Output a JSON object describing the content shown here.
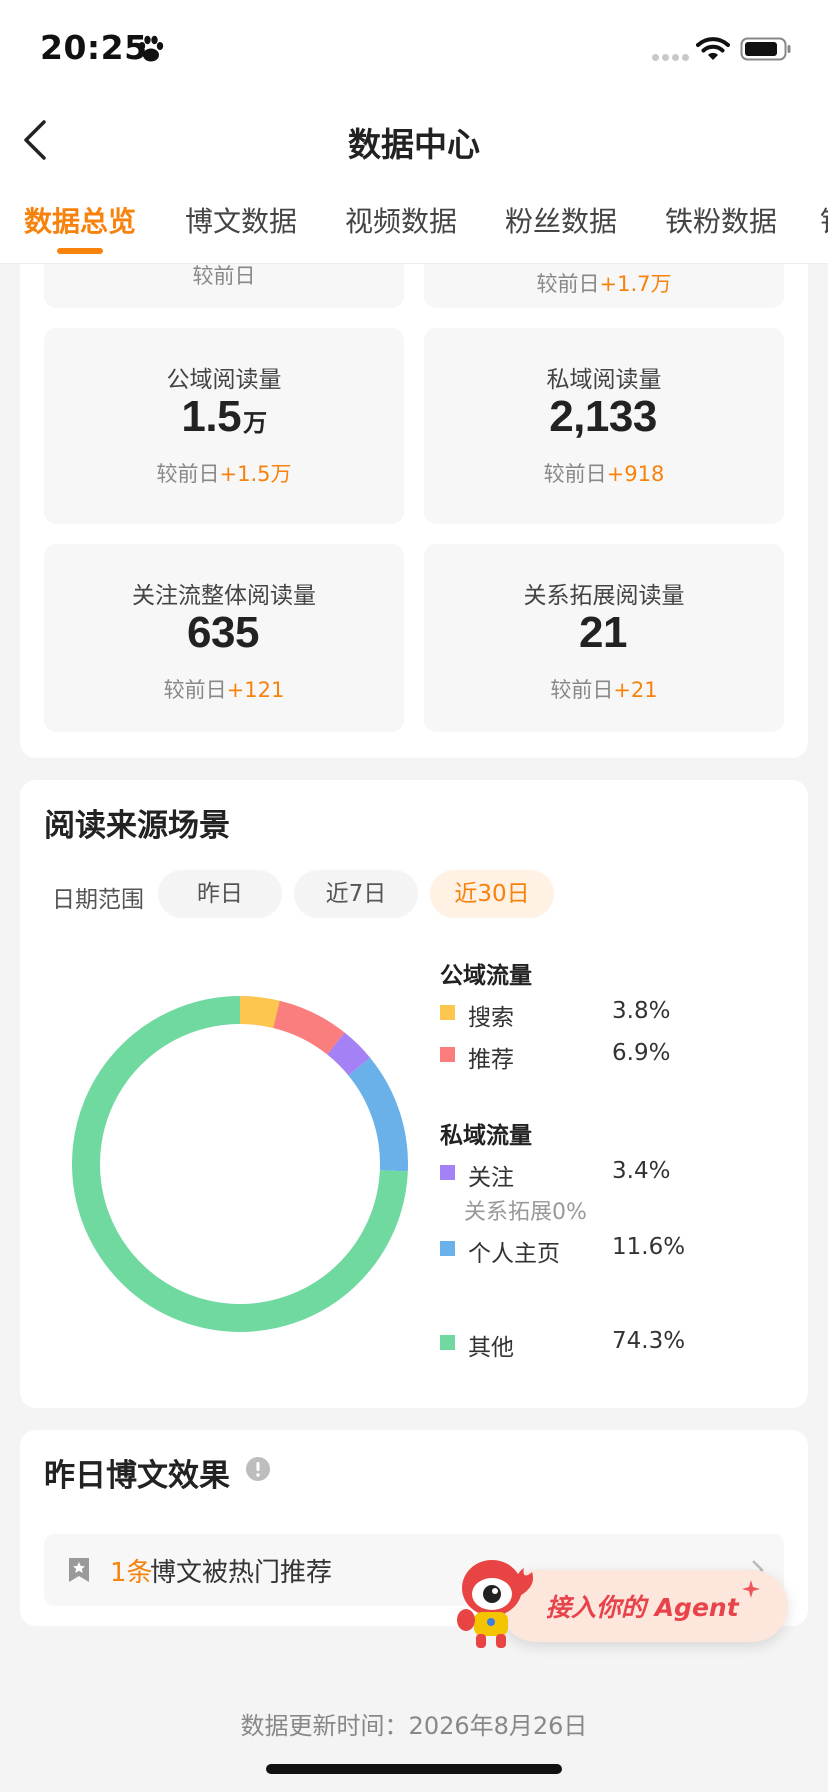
{
  "status_bar": {
    "time": "20:25"
  },
  "nav": {
    "title": "数据中心"
  },
  "tabs": [
    {
      "label": "数据总览",
      "active": true
    },
    {
      "label": "博文数据"
    },
    {
      "label": "视频数据"
    },
    {
      "label": "粉丝数据"
    },
    {
      "label": "铁粉数据"
    },
    {
      "label": "铁"
    }
  ],
  "top_partial": {
    "left_cmp": "较前日",
    "right_cmp_prefix": "较前日",
    "right_cmp_delta": "+1.7万"
  },
  "stats": [
    {
      "label": "公域阅读量",
      "value": "1.5",
      "unit": "万",
      "cmp_prefix": "较前日",
      "cmp_delta": "+1.5万"
    },
    {
      "label": "私域阅读量",
      "value": "2,133",
      "unit": "",
      "cmp_prefix": "较前日",
      "cmp_delta": "+918"
    },
    {
      "label": "关注流整体阅读量",
      "value": "635",
      "unit": "",
      "cmp_prefix": "较前日",
      "cmp_delta": "+121"
    },
    {
      "label": "关系拓展阅读量",
      "value": "21",
      "unit": "",
      "cmp_prefix": "较前日",
      "cmp_delta": "+21"
    }
  ],
  "source": {
    "title": "阅读来源场景",
    "date_label": "日期范围",
    "ranges": [
      "昨日",
      "近7日",
      "近30日"
    ],
    "active_range": "近30日",
    "public_head": "公域流量",
    "private_head": "私域流量",
    "legend": [
      {
        "name": "搜索",
        "pct": "3.8%",
        "color": "#fcc64f"
      },
      {
        "name": "推荐",
        "pct": "6.9%",
        "color": "#fb7e7e"
      },
      {
        "name": "关注",
        "pct": "3.4%",
        "color": "#a482f6"
      },
      {
        "name": "个人主页",
        "pct": "11.6%",
        "color": "#6ab1e9"
      },
      {
        "name": "其他",
        "pct": "74.3%",
        "color": "#6fd9a0"
      }
    ],
    "follow_sub": "关系拓展0%",
    "donut_values": [
      3.8,
      6.9,
      3.4,
      11.6,
      74.3
    ]
  },
  "yesterday": {
    "title": "昨日博文效果",
    "hot_count": "1条",
    "hot_text": "博文被热门推荐"
  },
  "agent": {
    "label": "接入你的 Agent"
  },
  "footer": {
    "update_time": "数据更新时间：2026年8月26日"
  }
}
